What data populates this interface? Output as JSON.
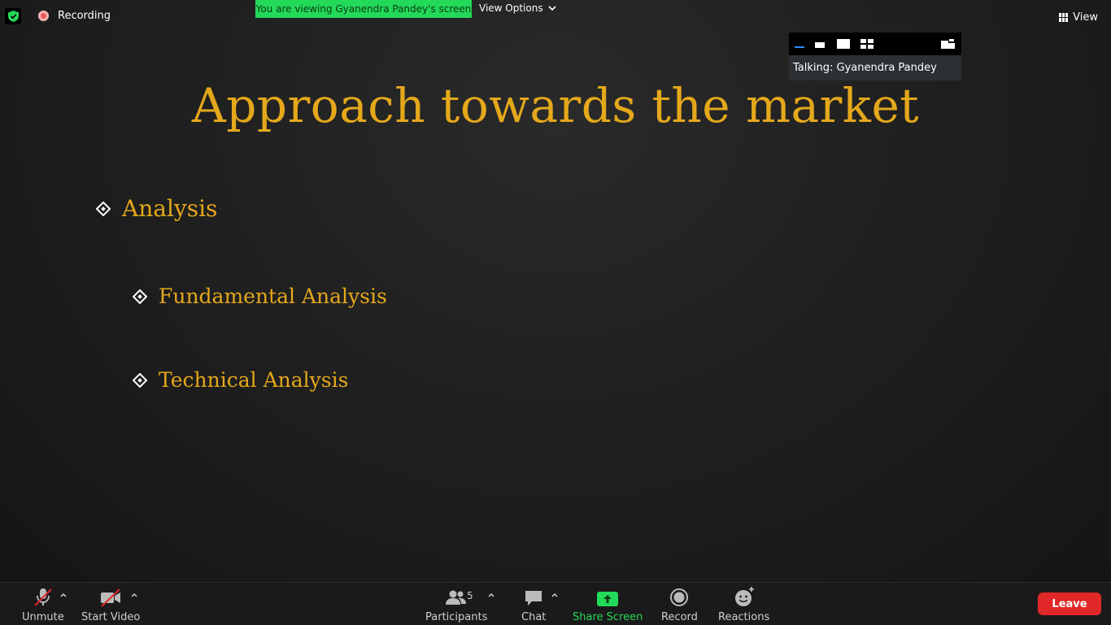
{
  "top": {
    "recording_label": "Recording",
    "viewing_banner": "You are viewing Gyanendra Pandey's screen",
    "view_options_label": "View Options",
    "view_label": "View"
  },
  "float_panel": {
    "talking_label": "Talking: Gyanendra Pandey"
  },
  "slide": {
    "title": "Approach towards the market",
    "bullets": [
      {
        "text": "Analysis"
      },
      {
        "text": "Fundamental Analysis"
      },
      {
        "text": "Technical Analysis"
      }
    ]
  },
  "toolbar": {
    "unmute": "Unmute",
    "start_video": "Start Video",
    "participants": "Participants",
    "participants_count": "5",
    "chat": "Chat",
    "share_screen": "Share Screen",
    "record": "Record",
    "reactions": "Reactions",
    "leave": "Leave"
  },
  "colors": {
    "slide_text": "#e5a81b",
    "banner_green": "#23d959",
    "leave_red": "#e02828"
  }
}
